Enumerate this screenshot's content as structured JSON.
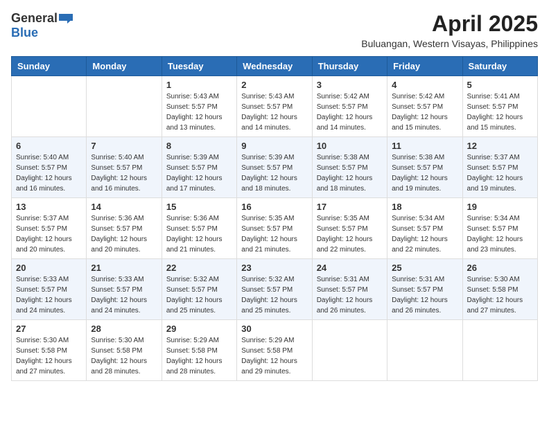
{
  "header": {
    "logo_general": "General",
    "logo_blue": "Blue",
    "month_year": "April 2025",
    "location": "Buluangan, Western Visayas, Philippines"
  },
  "days_of_week": [
    "Sunday",
    "Monday",
    "Tuesday",
    "Wednesday",
    "Thursday",
    "Friday",
    "Saturday"
  ],
  "weeks": [
    [
      {
        "day": "",
        "info": ""
      },
      {
        "day": "",
        "info": ""
      },
      {
        "day": "1",
        "info": "Sunrise: 5:43 AM\nSunset: 5:57 PM\nDaylight: 12 hours and 13 minutes."
      },
      {
        "day": "2",
        "info": "Sunrise: 5:43 AM\nSunset: 5:57 PM\nDaylight: 12 hours and 14 minutes."
      },
      {
        "day": "3",
        "info": "Sunrise: 5:42 AM\nSunset: 5:57 PM\nDaylight: 12 hours and 14 minutes."
      },
      {
        "day": "4",
        "info": "Sunrise: 5:42 AM\nSunset: 5:57 PM\nDaylight: 12 hours and 15 minutes."
      },
      {
        "day": "5",
        "info": "Sunrise: 5:41 AM\nSunset: 5:57 PM\nDaylight: 12 hours and 15 minutes."
      }
    ],
    [
      {
        "day": "6",
        "info": "Sunrise: 5:40 AM\nSunset: 5:57 PM\nDaylight: 12 hours and 16 minutes."
      },
      {
        "day": "7",
        "info": "Sunrise: 5:40 AM\nSunset: 5:57 PM\nDaylight: 12 hours and 16 minutes."
      },
      {
        "day": "8",
        "info": "Sunrise: 5:39 AM\nSunset: 5:57 PM\nDaylight: 12 hours and 17 minutes."
      },
      {
        "day": "9",
        "info": "Sunrise: 5:39 AM\nSunset: 5:57 PM\nDaylight: 12 hours and 18 minutes."
      },
      {
        "day": "10",
        "info": "Sunrise: 5:38 AM\nSunset: 5:57 PM\nDaylight: 12 hours and 18 minutes."
      },
      {
        "day": "11",
        "info": "Sunrise: 5:38 AM\nSunset: 5:57 PM\nDaylight: 12 hours and 19 minutes."
      },
      {
        "day": "12",
        "info": "Sunrise: 5:37 AM\nSunset: 5:57 PM\nDaylight: 12 hours and 19 minutes."
      }
    ],
    [
      {
        "day": "13",
        "info": "Sunrise: 5:37 AM\nSunset: 5:57 PM\nDaylight: 12 hours and 20 minutes."
      },
      {
        "day": "14",
        "info": "Sunrise: 5:36 AM\nSunset: 5:57 PM\nDaylight: 12 hours and 20 minutes."
      },
      {
        "day": "15",
        "info": "Sunrise: 5:36 AM\nSunset: 5:57 PM\nDaylight: 12 hours and 21 minutes."
      },
      {
        "day": "16",
        "info": "Sunrise: 5:35 AM\nSunset: 5:57 PM\nDaylight: 12 hours and 21 minutes."
      },
      {
        "day": "17",
        "info": "Sunrise: 5:35 AM\nSunset: 5:57 PM\nDaylight: 12 hours and 22 minutes."
      },
      {
        "day": "18",
        "info": "Sunrise: 5:34 AM\nSunset: 5:57 PM\nDaylight: 12 hours and 22 minutes."
      },
      {
        "day": "19",
        "info": "Sunrise: 5:34 AM\nSunset: 5:57 PM\nDaylight: 12 hours and 23 minutes."
      }
    ],
    [
      {
        "day": "20",
        "info": "Sunrise: 5:33 AM\nSunset: 5:57 PM\nDaylight: 12 hours and 24 minutes."
      },
      {
        "day": "21",
        "info": "Sunrise: 5:33 AM\nSunset: 5:57 PM\nDaylight: 12 hours and 24 minutes."
      },
      {
        "day": "22",
        "info": "Sunrise: 5:32 AM\nSunset: 5:57 PM\nDaylight: 12 hours and 25 minutes."
      },
      {
        "day": "23",
        "info": "Sunrise: 5:32 AM\nSunset: 5:57 PM\nDaylight: 12 hours and 25 minutes."
      },
      {
        "day": "24",
        "info": "Sunrise: 5:31 AM\nSunset: 5:57 PM\nDaylight: 12 hours and 26 minutes."
      },
      {
        "day": "25",
        "info": "Sunrise: 5:31 AM\nSunset: 5:57 PM\nDaylight: 12 hours and 26 minutes."
      },
      {
        "day": "26",
        "info": "Sunrise: 5:30 AM\nSunset: 5:58 PM\nDaylight: 12 hours and 27 minutes."
      }
    ],
    [
      {
        "day": "27",
        "info": "Sunrise: 5:30 AM\nSunset: 5:58 PM\nDaylight: 12 hours and 27 minutes."
      },
      {
        "day": "28",
        "info": "Sunrise: 5:30 AM\nSunset: 5:58 PM\nDaylight: 12 hours and 28 minutes."
      },
      {
        "day": "29",
        "info": "Sunrise: 5:29 AM\nSunset: 5:58 PM\nDaylight: 12 hours and 28 minutes."
      },
      {
        "day": "30",
        "info": "Sunrise: 5:29 AM\nSunset: 5:58 PM\nDaylight: 12 hours and 29 minutes."
      },
      {
        "day": "",
        "info": ""
      },
      {
        "day": "",
        "info": ""
      },
      {
        "day": "",
        "info": ""
      }
    ]
  ]
}
